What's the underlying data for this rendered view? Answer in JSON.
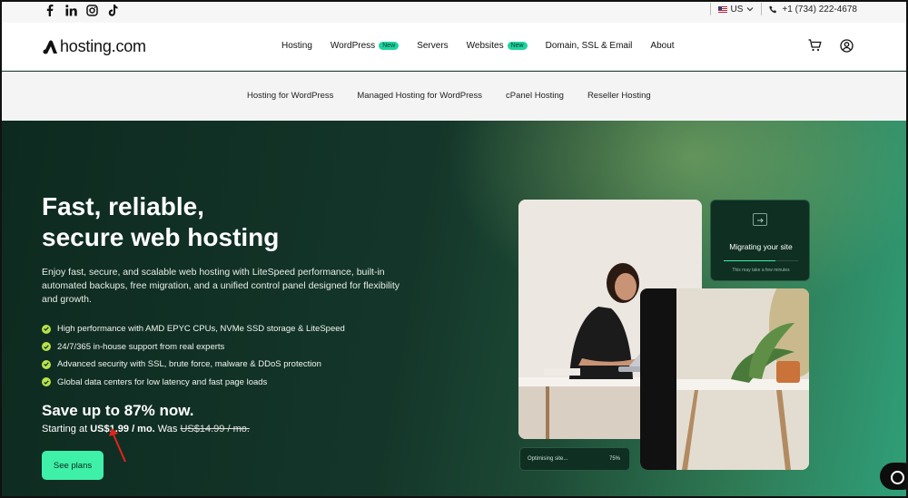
{
  "social": {
    "icons": [
      "facebook-icon",
      "linkedin-icon",
      "instagram-icon",
      "tiktok-icon"
    ]
  },
  "utility": {
    "region": "US",
    "phone": "+1 (734) 222-4678"
  },
  "header": {
    "logo_text": "hosting.com",
    "menu": [
      {
        "label": "Hosting",
        "badge": ""
      },
      {
        "label": "WordPress",
        "badge": "New"
      },
      {
        "label": "Servers",
        "badge": ""
      },
      {
        "label": "Websites",
        "badge": "New"
      },
      {
        "label": "Domain, SSL & Email",
        "badge": ""
      },
      {
        "label": "About",
        "badge": ""
      }
    ]
  },
  "subnav": [
    "Hosting for WordPress",
    "Managed Hosting for WordPress",
    "cPanel Hosting",
    "Reseller Hosting"
  ],
  "hero": {
    "title_line1": "Fast, reliable,",
    "title_line2": "secure web hosting",
    "description": "Enjoy fast, secure, and scalable web hosting with LiteSpeed performance, built-in automated backups, free migration, and a unified control panel designed for flexibility and growth.",
    "features": [
      "High performance with AMD EPYC CPUs, NVMe SSD storage & LiteSpeed",
      "24/7/365 in-house support from real experts",
      "Advanced security with SSL, brute force, malware & DDoS protection",
      "Global data centers for low latency and fast page loads"
    ],
    "save_prefix": "Save up to ",
    "save_percent": "87%",
    "save_suffix": " now.",
    "price_prefix": "Starting at ",
    "price": "US$1.99 / mo.",
    "was_prefix": " Was ",
    "was_price": "US$14.99 / mo.",
    "cta": "See plans"
  },
  "cards": {
    "migrating_title": "Migrating your site",
    "migrating_note": "This may take a few minutes",
    "optimising_label": "Optimising site...",
    "optimising_percent": "75%",
    "migration_progress": 0.7
  },
  "colors": {
    "accent": "#3ef0a8",
    "badge": "#1fd3a0",
    "check": "#b7e24a",
    "hero_dark": "#0e2a20"
  }
}
